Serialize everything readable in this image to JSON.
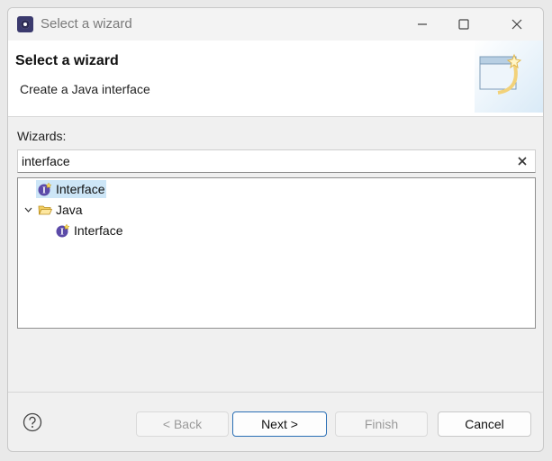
{
  "window": {
    "title": "Select a wizard"
  },
  "header": {
    "title": "Select a wizard",
    "description": "Create a Java interface"
  },
  "wizards": {
    "label": "Wizards:",
    "filter_value": "interface",
    "tree": [
      {
        "label": "Interface",
        "selected": true
      },
      {
        "label": "Java",
        "expanded": true
      },
      {
        "label": "Interface"
      }
    ]
  },
  "buttons": {
    "back": "< Back",
    "next": "Next >",
    "finish": "Finish",
    "cancel": "Cancel"
  },
  "colors": {
    "selection": "#cde6f7",
    "default_button_border": "#2a6fb5",
    "interface_icon": "#5b4aa8"
  },
  "icons": [
    "app-icon",
    "minimize-icon",
    "maximize-icon",
    "close-icon",
    "wizard-banner-icon",
    "clear-icon",
    "interface-icon",
    "folder-open-icon",
    "chevron-down-icon",
    "help-icon"
  ]
}
